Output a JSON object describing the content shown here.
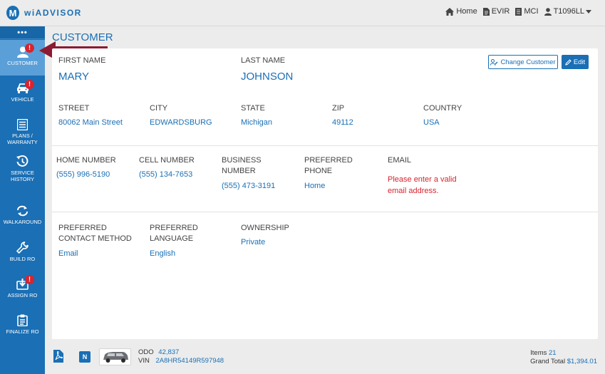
{
  "app": {
    "logo_letter": "M",
    "name": "wiADVISOR"
  },
  "topnav": {
    "home": "Home",
    "evir": "EVIR",
    "mci": "MCI",
    "user": "T1096LL"
  },
  "sidebar": {
    "dots": "•••",
    "items": [
      {
        "label": "CUSTOMER",
        "badge": "!"
      },
      {
        "label": "VEHICLE",
        "badge": "!"
      },
      {
        "label": "PLANS / WARRANTY"
      },
      {
        "label": "SERVICE HISTORY"
      },
      {
        "label": "WALKAROUND"
      },
      {
        "label": "BUILD RO"
      },
      {
        "label": "ASSIGN RO",
        "badge": "!"
      },
      {
        "label": "FINALIZE RO"
      }
    ]
  },
  "page": {
    "title": "CUSTOMER"
  },
  "buttons": {
    "change_customer": "Change Customer",
    "edit": "Edit"
  },
  "customer": {
    "first_name": {
      "label": "FIRST NAME",
      "value": "MARY"
    },
    "last_name": {
      "label": "LAST NAME",
      "value": "JOHNSON"
    },
    "street": {
      "label": "STREET",
      "value": "80062 Main Street"
    },
    "city": {
      "label": "CITY",
      "value": "EDWARDSBURG"
    },
    "state": {
      "label": "STATE",
      "value": "Michigan"
    },
    "zip": {
      "label": "ZIP",
      "value": "49112"
    },
    "country": {
      "label": "COUNTRY",
      "value": "USA"
    },
    "home_number": {
      "label": "HOME NUMBER",
      "value": "(555) 996-5190"
    },
    "cell_number": {
      "label": "CELL NUMBER",
      "value": "(555) 134-7653"
    },
    "business_number": {
      "label_1": "BUSINESS",
      "label_2": "NUMBER",
      "value": "(555) 473-3191"
    },
    "preferred_phone": {
      "label_1": "PREFERRED",
      "label_2": "PHONE",
      "value": "Home"
    },
    "email": {
      "label": "EMAIL",
      "error_1": "Please enter a valid",
      "error_2": "email address."
    },
    "preferred_contact": {
      "label_1": "PREFERRED",
      "label_2": "CONTACT METHOD",
      "value": "Email"
    },
    "preferred_language": {
      "label_1": "PREFERRED",
      "label_2": "LANGUAGE",
      "value": "English"
    },
    "ownership": {
      "label": "OWNERSHIP",
      "value": "Private"
    }
  },
  "footer": {
    "n_badge": "N",
    "odo_label": "ODO",
    "odo_value": "42,837",
    "vin_label": "VIN",
    "vin_value": "2A8HR54149R597948",
    "items_label": "Items",
    "items_value": "21",
    "grand_total_label": "Grand Total",
    "grand_total_value": "$1,394.01"
  },
  "colors": {
    "brand": "#1a6fb5",
    "sidebar_active": "#5a9fd8",
    "alert": "#d9232e",
    "arrow": "#8b1a32"
  }
}
